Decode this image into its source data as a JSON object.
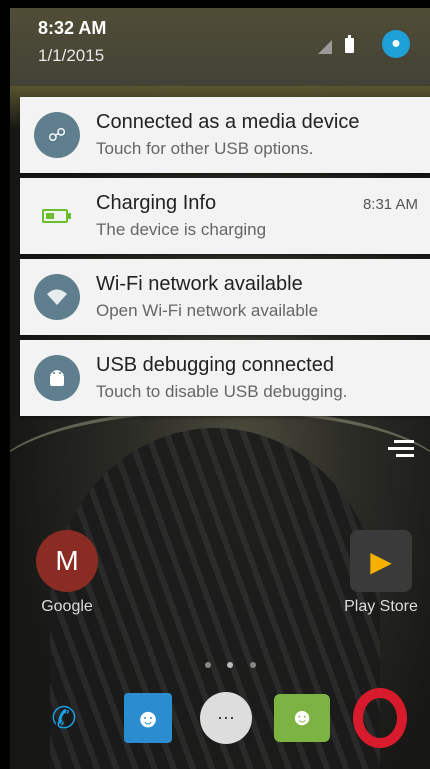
{
  "status_bar": {
    "time": "8:32 AM",
    "date": "1/1/2015"
  },
  "notifications": [
    {
      "icon": "usb-icon",
      "title": "Connected as a media device",
      "text": "Touch for other USB options.",
      "time": ""
    },
    {
      "icon": "battery-charging-icon",
      "title": "Charging Info",
      "text": "The device is charging",
      "time": "8:31 AM"
    },
    {
      "icon": "wifi-icon",
      "title": "Wi-Fi network available",
      "text": "Open Wi-Fi network available",
      "time": ""
    },
    {
      "icon": "android-debug-icon",
      "title": "USB debugging connected",
      "text": "Touch to disable USB debugging.",
      "time": ""
    }
  ],
  "home": {
    "apps": [
      {
        "name": "Google",
        "icon": "gmail-icon"
      },
      {
        "name": "Play Store",
        "icon": "play-store-icon"
      }
    ],
    "dock": [
      {
        "icon": "phone-icon"
      },
      {
        "icon": "contacts-icon"
      },
      {
        "icon": "app-drawer-icon"
      },
      {
        "icon": "messaging-icon"
      },
      {
        "icon": "opera-icon"
      }
    ]
  }
}
